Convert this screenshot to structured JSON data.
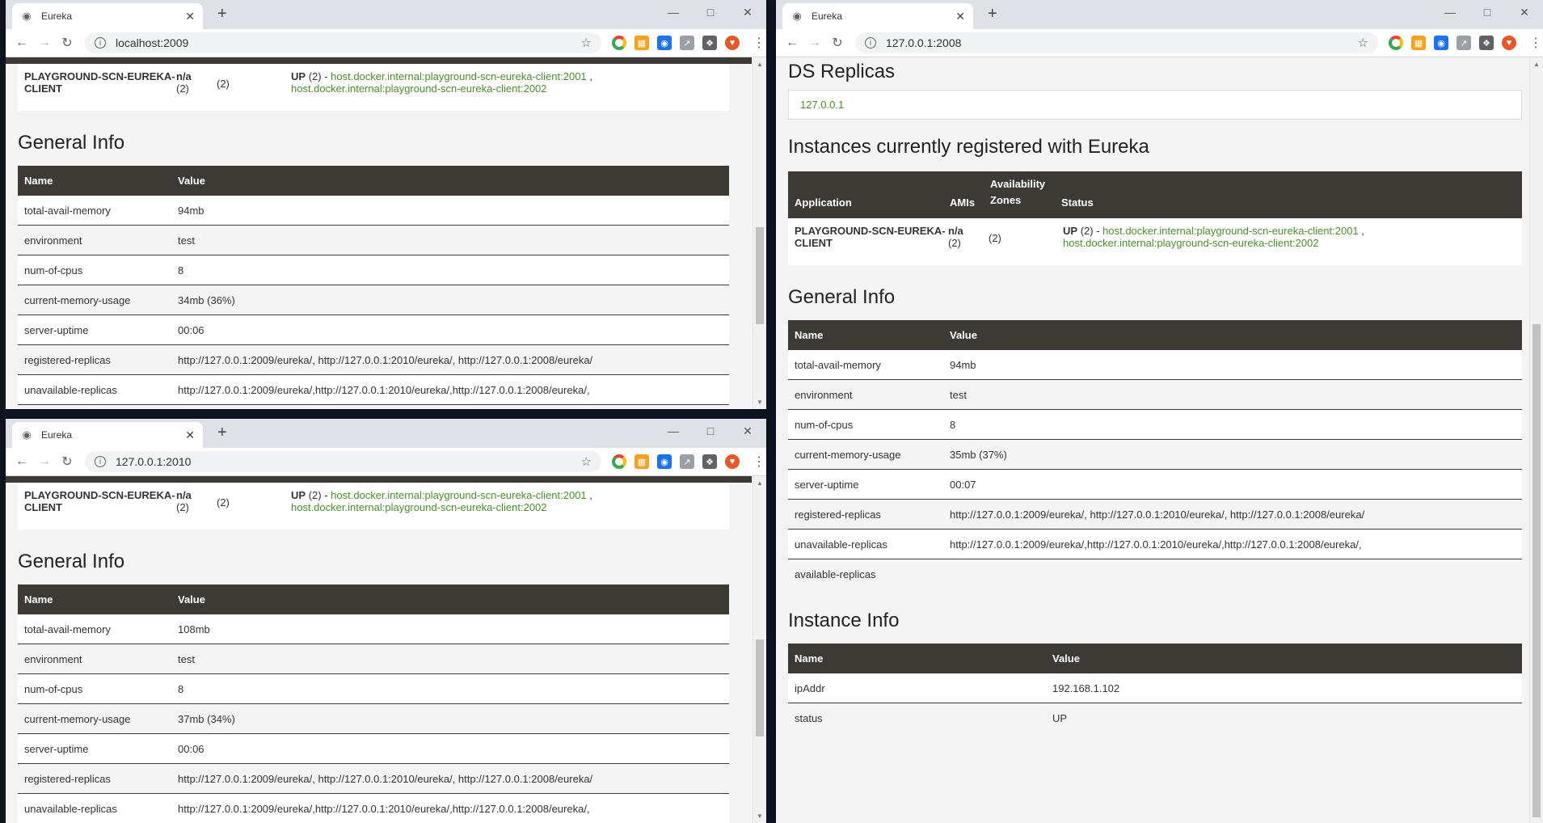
{
  "windows": {
    "w1": {
      "tab_title": "Eureka",
      "url": "localhost:2009",
      "app": {
        "name": "PLAYGROUND-SCN-EUREKA-CLIENT",
        "amis": "n/a",
        "amis_count": "(2)",
        "zones": "(2)",
        "status_prefix": "UP",
        "status_count": "(2)",
        "links": [
          "host.docker.internal:playground-scn-eureka-client:2001",
          "host.docker.internal:playground-scn-eureka-client:2002"
        ]
      },
      "general_info_title": "General Info",
      "table_headers": [
        "Name",
        "Value"
      ],
      "rows": [
        [
          "total-avail-memory",
          "94mb"
        ],
        [
          "environment",
          "test"
        ],
        [
          "num-of-cpus",
          "8"
        ],
        [
          "current-memory-usage",
          "34mb (36%)"
        ],
        [
          "server-uptime",
          "00:06"
        ],
        [
          "registered-replicas",
          "http://127.0.0.1:2009/eureka/, http://127.0.0.1:2010/eureka/, http://127.0.0.1:2008/eureka/"
        ],
        [
          "unavailable-replicas",
          "http://127.0.0.1:2009/eureka/,http://127.0.0.1:2010/eureka/,http://127.0.0.1:2008/eureka/,"
        ]
      ]
    },
    "w2": {
      "tab_title": "Eureka",
      "url": "127.0.0.1:2010",
      "app": {
        "name": "PLAYGROUND-SCN-EUREKA-CLIENT",
        "amis": "n/a",
        "amis_count": "(2)",
        "zones": "(2)",
        "status_prefix": "UP",
        "status_count": "(2)",
        "links": [
          "host.docker.internal:playground-scn-eureka-client:2001",
          "host.docker.internal:playground-scn-eureka-client:2002"
        ]
      },
      "general_info_title": "General Info",
      "table_headers": [
        "Name",
        "Value"
      ],
      "rows": [
        [
          "total-avail-memory",
          "108mb"
        ],
        [
          "environment",
          "test"
        ],
        [
          "num-of-cpus",
          "8"
        ],
        [
          "current-memory-usage",
          "37mb (34%)"
        ],
        [
          "server-uptime",
          "00:06"
        ],
        [
          "registered-replicas",
          "http://127.0.0.1:2009/eureka/, http://127.0.0.1:2010/eureka/, http://127.0.0.1:2008/eureka/"
        ],
        [
          "unavailable-replicas",
          "http://127.0.0.1:2009/eureka/,http://127.0.0.1:2010/eureka/,http://127.0.0.1:2008/eureka/,"
        ]
      ]
    },
    "w3": {
      "tab_title": "Eureka",
      "url": "127.0.0.1:2008",
      "ds_replicas_title": "DS Replicas",
      "ds_replica": "127.0.0.1",
      "instances_title": "Instances currently registered with Eureka",
      "instances_headers": [
        "Application",
        "AMIs",
        "Availability Zones",
        "Status"
      ],
      "app": {
        "name": "PLAYGROUND-SCN-EUREKA-CLIENT",
        "amis": "n/a",
        "amis_count": "(2)",
        "zones": "(2)",
        "status_prefix": "UP",
        "status_count": "(2)",
        "links": [
          "host.docker.internal:playground-scn-eureka-client:2001",
          "host.docker.internal:playground-scn-eureka-client:2002"
        ]
      },
      "general_info_title": "General Info",
      "table_headers": [
        "Name",
        "Value"
      ],
      "rows": [
        [
          "total-avail-memory",
          "94mb"
        ],
        [
          "environment",
          "test"
        ],
        [
          "num-of-cpus",
          "8"
        ],
        [
          "current-memory-usage",
          "35mb (37%)"
        ],
        [
          "server-uptime",
          "00:07"
        ],
        [
          "registered-replicas",
          "http://127.0.0.1:2009/eureka/, http://127.0.0.1:2010/eureka/, http://127.0.0.1:2008/eureka/"
        ],
        [
          "unavailable-replicas",
          "http://127.0.0.1:2009/eureka/,http://127.0.0.1:2010/eureka/,http://127.0.0.1:2008/eureka/,"
        ],
        [
          "available-replicas",
          ""
        ]
      ],
      "instance_info_title": "Instance Info",
      "instance_rows": [
        [
          "ipAddr",
          "192.168.1.102"
        ],
        [
          "status",
          "UP"
        ]
      ]
    }
  },
  "icons": {
    "tab": "globe-icon",
    "close": "close-icon",
    "new_tab": "plus-icon",
    "back": "back-arrow-icon",
    "forward": "forward-arrow-icon",
    "reload": "reload-icon",
    "info": "info-icon",
    "bookmark": "star-icon",
    "menu": "kebab-menu-icon"
  },
  "colors": {
    "table_header": "#3d3935",
    "link_green": "#4b8d2d",
    "page_bg": "#f4f4f4"
  }
}
